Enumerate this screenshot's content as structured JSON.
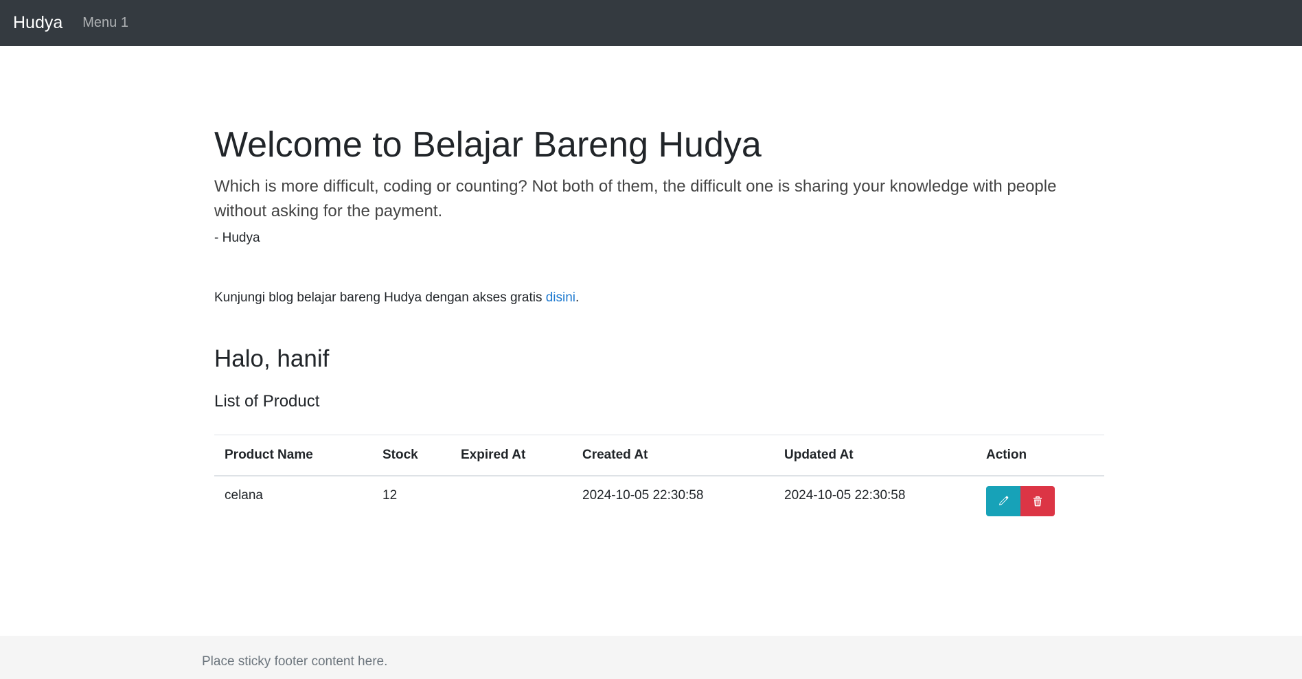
{
  "navbar": {
    "brand": "Hudya",
    "menu_item": "Menu 1"
  },
  "hero": {
    "title": "Welcome to Belajar Bareng Hudya",
    "lead": "Which is more difficult, coding or counting? Not both of them, the difficult one is sharing your knowledge with people without asking for the payment.",
    "author": "- Hudya"
  },
  "blog": {
    "text": "Kunjungi blog belajar bareng Hudya dengan akses gratis ",
    "link_label": "disini",
    "trailing": "."
  },
  "greeting": "Halo, hanif",
  "list_title": "List of Product",
  "table": {
    "headers": [
      "Product Name",
      "Stock",
      "Expired At",
      "Created At",
      "Updated At",
      "Action"
    ],
    "rows": [
      {
        "product_name": "celana",
        "stock": "12",
        "expired_at": "",
        "created_at": "2024-10-05 22:30:58",
        "updated_at": "2024-10-05 22:30:58",
        "actions": [
          "pencil-icon",
          "trash-icon"
        ]
      }
    ]
  },
  "colors": {
    "navbar_bg": "#343a40",
    "edit_button": "#17a2b8",
    "delete_button": "#dc3545",
    "link": "#1e7ad0",
    "footer_bg": "#f5f5f5"
  },
  "footer": {
    "text": "Place sticky footer content here."
  }
}
